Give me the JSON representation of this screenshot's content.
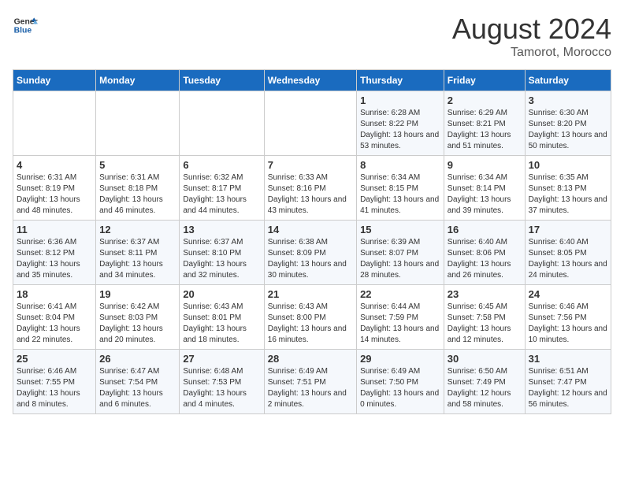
{
  "header": {
    "logo_line1": "General",
    "logo_line2": "Blue",
    "title": "August 2024",
    "subtitle": "Tamorot, Morocco"
  },
  "weekdays": [
    "Sunday",
    "Monday",
    "Tuesday",
    "Wednesday",
    "Thursday",
    "Friday",
    "Saturday"
  ],
  "weeks": [
    [
      {
        "day": "",
        "sunrise": "",
        "sunset": "",
        "daylight": ""
      },
      {
        "day": "",
        "sunrise": "",
        "sunset": "",
        "daylight": ""
      },
      {
        "day": "",
        "sunrise": "",
        "sunset": "",
        "daylight": ""
      },
      {
        "day": "",
        "sunrise": "",
        "sunset": "",
        "daylight": ""
      },
      {
        "day": "1",
        "sunrise": "Sunrise: 6:28 AM",
        "sunset": "Sunset: 8:22 PM",
        "daylight": "Daylight: 13 hours and 53 minutes."
      },
      {
        "day": "2",
        "sunrise": "Sunrise: 6:29 AM",
        "sunset": "Sunset: 8:21 PM",
        "daylight": "Daylight: 13 hours and 51 minutes."
      },
      {
        "day": "3",
        "sunrise": "Sunrise: 6:30 AM",
        "sunset": "Sunset: 8:20 PM",
        "daylight": "Daylight: 13 hours and 50 minutes."
      }
    ],
    [
      {
        "day": "4",
        "sunrise": "Sunrise: 6:31 AM",
        "sunset": "Sunset: 8:19 PM",
        "daylight": "Daylight: 13 hours and 48 minutes."
      },
      {
        "day": "5",
        "sunrise": "Sunrise: 6:31 AM",
        "sunset": "Sunset: 8:18 PM",
        "daylight": "Daylight: 13 hours and 46 minutes."
      },
      {
        "day": "6",
        "sunrise": "Sunrise: 6:32 AM",
        "sunset": "Sunset: 8:17 PM",
        "daylight": "Daylight: 13 hours and 44 minutes."
      },
      {
        "day": "7",
        "sunrise": "Sunrise: 6:33 AM",
        "sunset": "Sunset: 8:16 PM",
        "daylight": "Daylight: 13 hours and 43 minutes."
      },
      {
        "day": "8",
        "sunrise": "Sunrise: 6:34 AM",
        "sunset": "Sunset: 8:15 PM",
        "daylight": "Daylight: 13 hours and 41 minutes."
      },
      {
        "day": "9",
        "sunrise": "Sunrise: 6:34 AM",
        "sunset": "Sunset: 8:14 PM",
        "daylight": "Daylight: 13 hours and 39 minutes."
      },
      {
        "day": "10",
        "sunrise": "Sunrise: 6:35 AM",
        "sunset": "Sunset: 8:13 PM",
        "daylight": "Daylight: 13 hours and 37 minutes."
      }
    ],
    [
      {
        "day": "11",
        "sunrise": "Sunrise: 6:36 AM",
        "sunset": "Sunset: 8:12 PM",
        "daylight": "Daylight: 13 hours and 35 minutes."
      },
      {
        "day": "12",
        "sunrise": "Sunrise: 6:37 AM",
        "sunset": "Sunset: 8:11 PM",
        "daylight": "Daylight: 13 hours and 34 minutes."
      },
      {
        "day": "13",
        "sunrise": "Sunrise: 6:37 AM",
        "sunset": "Sunset: 8:10 PM",
        "daylight": "Daylight: 13 hours and 32 minutes."
      },
      {
        "day": "14",
        "sunrise": "Sunrise: 6:38 AM",
        "sunset": "Sunset: 8:09 PM",
        "daylight": "Daylight: 13 hours and 30 minutes."
      },
      {
        "day": "15",
        "sunrise": "Sunrise: 6:39 AM",
        "sunset": "Sunset: 8:07 PM",
        "daylight": "Daylight: 13 hours and 28 minutes."
      },
      {
        "day": "16",
        "sunrise": "Sunrise: 6:40 AM",
        "sunset": "Sunset: 8:06 PM",
        "daylight": "Daylight: 13 hours and 26 minutes."
      },
      {
        "day": "17",
        "sunrise": "Sunrise: 6:40 AM",
        "sunset": "Sunset: 8:05 PM",
        "daylight": "Daylight: 13 hours and 24 minutes."
      }
    ],
    [
      {
        "day": "18",
        "sunrise": "Sunrise: 6:41 AM",
        "sunset": "Sunset: 8:04 PM",
        "daylight": "Daylight: 13 hours and 22 minutes."
      },
      {
        "day": "19",
        "sunrise": "Sunrise: 6:42 AM",
        "sunset": "Sunset: 8:03 PM",
        "daylight": "Daylight: 13 hours and 20 minutes."
      },
      {
        "day": "20",
        "sunrise": "Sunrise: 6:43 AM",
        "sunset": "Sunset: 8:01 PM",
        "daylight": "Daylight: 13 hours and 18 minutes."
      },
      {
        "day": "21",
        "sunrise": "Sunrise: 6:43 AM",
        "sunset": "Sunset: 8:00 PM",
        "daylight": "Daylight: 13 hours and 16 minutes."
      },
      {
        "day": "22",
        "sunrise": "Sunrise: 6:44 AM",
        "sunset": "Sunset: 7:59 PM",
        "daylight": "Daylight: 13 hours and 14 minutes."
      },
      {
        "day": "23",
        "sunrise": "Sunrise: 6:45 AM",
        "sunset": "Sunset: 7:58 PM",
        "daylight": "Daylight: 13 hours and 12 minutes."
      },
      {
        "day": "24",
        "sunrise": "Sunrise: 6:46 AM",
        "sunset": "Sunset: 7:56 PM",
        "daylight": "Daylight: 13 hours and 10 minutes."
      }
    ],
    [
      {
        "day": "25",
        "sunrise": "Sunrise: 6:46 AM",
        "sunset": "Sunset: 7:55 PM",
        "daylight": "Daylight: 13 hours and 8 minutes."
      },
      {
        "day": "26",
        "sunrise": "Sunrise: 6:47 AM",
        "sunset": "Sunset: 7:54 PM",
        "daylight": "Daylight: 13 hours and 6 minutes."
      },
      {
        "day": "27",
        "sunrise": "Sunrise: 6:48 AM",
        "sunset": "Sunset: 7:53 PM",
        "daylight": "Daylight: 13 hours and 4 minutes."
      },
      {
        "day": "28",
        "sunrise": "Sunrise: 6:49 AM",
        "sunset": "Sunset: 7:51 PM",
        "daylight": "Daylight: 13 hours and 2 minutes."
      },
      {
        "day": "29",
        "sunrise": "Sunrise: 6:49 AM",
        "sunset": "Sunset: 7:50 PM",
        "daylight": "Daylight: 13 hours and 0 minutes."
      },
      {
        "day": "30",
        "sunrise": "Sunrise: 6:50 AM",
        "sunset": "Sunset: 7:49 PM",
        "daylight": "Daylight: 12 hours and 58 minutes."
      },
      {
        "day": "31",
        "sunrise": "Sunrise: 6:51 AM",
        "sunset": "Sunset: 7:47 PM",
        "daylight": "Daylight: 12 hours and 56 minutes."
      }
    ]
  ]
}
